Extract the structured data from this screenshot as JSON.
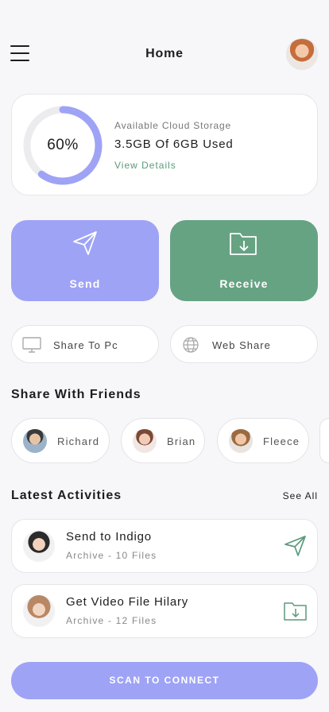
{
  "header": {
    "title": "Home",
    "menu_icon": "hamburger-menu-icon",
    "avatar": "user-avatar"
  },
  "storage": {
    "percent_label": "60%",
    "percent_value": 0.6,
    "heading": "Available Cloud Storage",
    "usage": "3.5GB Of 6GB Used",
    "link": "View Details",
    "ring_color": "#9ea3f6",
    "track_color": "#ececee"
  },
  "actions": {
    "send": {
      "label": "Send",
      "icon": "paper-plane-icon",
      "color": "#9ea3f6"
    },
    "receive": {
      "label": "Receive",
      "icon": "folder-download-icon",
      "color": "#66a383"
    }
  },
  "share_options": [
    {
      "label": "Share To Pc",
      "icon": "monitor-icon"
    },
    {
      "label": "Web Share",
      "icon": "globe-icon"
    }
  ],
  "friends": {
    "title": "Share With Friends",
    "items": [
      {
        "name": "Richard"
      },
      {
        "name": "Brian"
      },
      {
        "name": "Fleece"
      }
    ]
  },
  "activities": {
    "title": "Latest Activities",
    "see_all": "See All",
    "items": [
      {
        "title": "Send to Indigo",
        "subtitle": "Archive - 10 Files",
        "icon": "paper-plane-icon"
      },
      {
        "title": "Get Video File Hilary",
        "subtitle": "Archive - 12 Files",
        "icon": "folder-download-icon"
      }
    ]
  },
  "scan_button": "SCAN TO CONNECT",
  "accent_green": "#5a9a7b"
}
